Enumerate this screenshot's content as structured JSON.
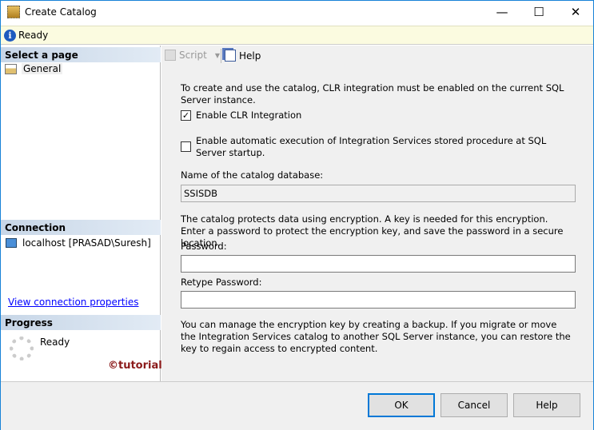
{
  "window": {
    "title": "Create Catalog",
    "minimize": "—",
    "maximize": "☐",
    "close": "✕"
  },
  "status": {
    "text": "Ready"
  },
  "sidebar": {
    "select_page": "Select a page",
    "pages": [
      {
        "label": "General"
      }
    ],
    "connection_header": "Connection",
    "connection": "localhost [PRASAD\\Suresh]",
    "view_connection": "View connection properties",
    "progress_header": "Progress",
    "progress_status": "Ready"
  },
  "watermark": "©tutorialgateway.org",
  "toolbar": {
    "script": "Script",
    "help": "Help"
  },
  "main": {
    "clr_note": "To create and use the catalog, CLR integration must be enabled on the current SQL Server instance.",
    "enable_clr": {
      "label": "Enable CLR Integration",
      "checked": true
    },
    "auto_exec": {
      "label": "Enable automatic execution of Integration Services stored procedure at SQL Server startup.",
      "checked": false
    },
    "catalog_name_label": "Name of the catalog database:",
    "catalog_name_value": "SSISDB",
    "encryption_note": "The catalog protects data using encryption. A key is needed for this encryption. Enter a password to protect the encryption key, and save the password in a secure location.",
    "password_label": "Password:",
    "password_value": "",
    "retype_label": "Retype Password:",
    "retype_value": "",
    "backup_note": "You can manage the encryption key by creating a backup. If you migrate or move the Integration Services catalog to another SQL Server instance, you can restore the key to regain access to encrypted content."
  },
  "buttons": {
    "ok": "OK",
    "cancel": "Cancel",
    "help": "Help"
  }
}
